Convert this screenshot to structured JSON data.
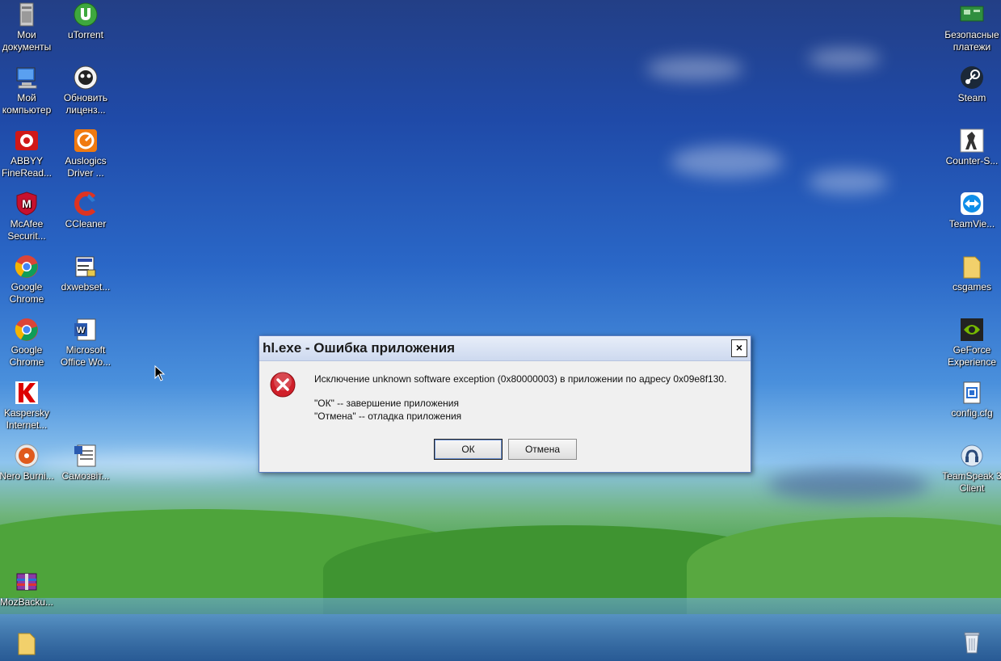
{
  "desktop": {
    "left_icons": [
      {
        "name": "Мои документы"
      },
      {
        "name": "uTorrent"
      },
      {
        "name": "Мой компьютер"
      },
      {
        "name": "Обновить лиценз..."
      },
      {
        "name": "ABBYY FineRead..."
      },
      {
        "name": "Auslogics Driver ..."
      },
      {
        "name": "McAfee Securit..."
      },
      {
        "name": "CCleaner"
      },
      {
        "name": "Google Chrome"
      },
      {
        "name": "dxwebset..."
      },
      {
        "name": "Google Chrome"
      },
      {
        "name": "Microsoft Office Wo..."
      },
      {
        "name": "Kaspersky Internet..."
      },
      {
        "name": "Nero Burni..."
      },
      {
        "name": "Самозвіт..."
      },
      {
        "name": "MozBacku..."
      }
    ],
    "right_icons": [
      {
        "name": "Безопасные платежи"
      },
      {
        "name": "Steam"
      },
      {
        "name": "Counter-S..."
      },
      {
        "name": "TeamVie..."
      },
      {
        "name": "csgames"
      },
      {
        "name": "GeForce Experience"
      },
      {
        "name": "config.cfg"
      },
      {
        "name": "TeamSpeak 3 Client"
      }
    ]
  },
  "dialog": {
    "title": "hl.exe - Ошибка приложения",
    "close_label": "×",
    "message_line1": "Исключение unknown software exception (0x80000003) в приложении по адресу 0x09e8f130.",
    "message_line2": "\"ОК\" -- завершение приложения",
    "message_line3": "\"Отмена\" -- отладка приложения",
    "ok_label": "ОК",
    "cancel_label": "Отмена"
  },
  "colors": {
    "error_red": "#d0202a",
    "title_bar": "#cdd9ef"
  }
}
